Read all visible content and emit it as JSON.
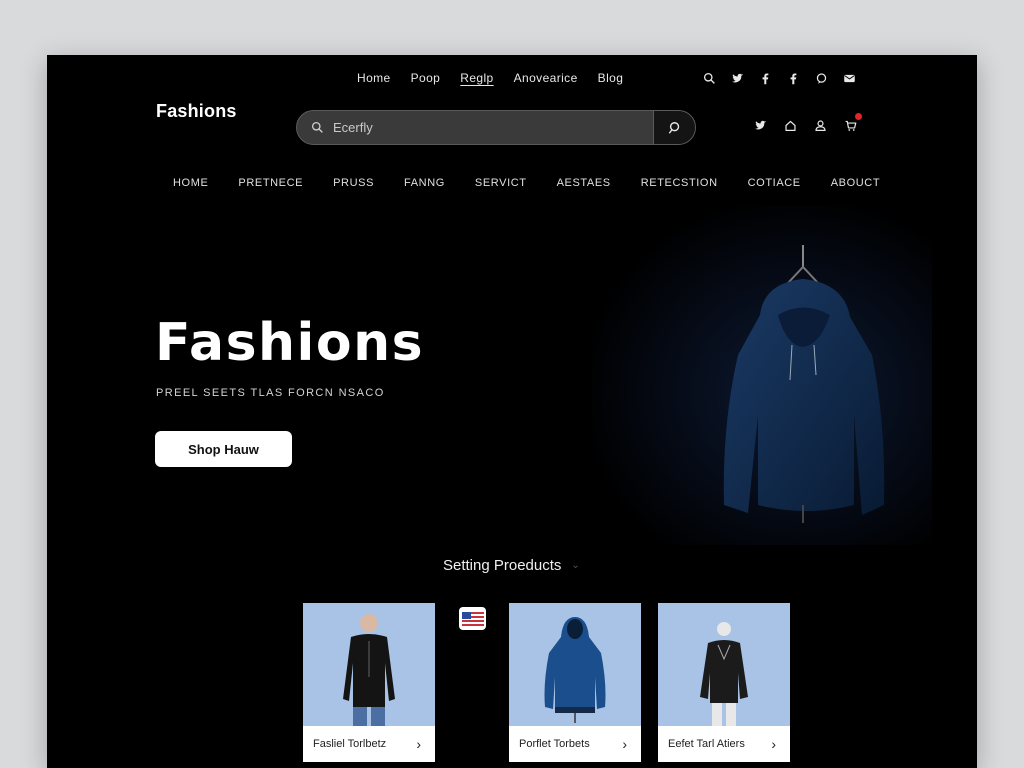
{
  "top_nav": {
    "items": [
      {
        "label": "Home",
        "active": false
      },
      {
        "label": "Poop",
        "active": false
      },
      {
        "label": "Reglp",
        "active": true
      },
      {
        "label": "Anovearice",
        "active": false
      },
      {
        "label": "Blog",
        "active": false
      }
    ]
  },
  "top_icons": [
    "search-icon",
    "twitter-icon",
    "facebook-icon",
    "facebook-icon",
    "chat-icon",
    "mail-icon"
  ],
  "brand": "Fashions",
  "search": {
    "placeholder": "Ecerfly"
  },
  "util_icons": [
    "twitter-icon",
    "home-icon",
    "account-icon",
    "cart-icon"
  ],
  "main_nav": [
    "HOME",
    "PRETNECE",
    "PRUSS",
    "FANNG",
    "SERVICT",
    "AESTAES",
    "RETECSTION",
    "COTIACE",
    "ABOUCT"
  ],
  "hero": {
    "title": "Fashions",
    "subtitle": "PREEL SEETS TLAS FORCN NSACO",
    "cta": "Shop Hauw"
  },
  "products": {
    "title": "Setting Proeducts",
    "items": [
      {
        "name": "Fasliel Torlbetz"
      },
      {
        "name": "Porflet Torbets"
      },
      {
        "name": "Eefet Tarl Atiers"
      }
    ]
  },
  "colors": {
    "background": "#000000",
    "accent": "#e0262a",
    "card_photo_bg": "#a9c3e6",
    "hoodie": "#123056"
  }
}
